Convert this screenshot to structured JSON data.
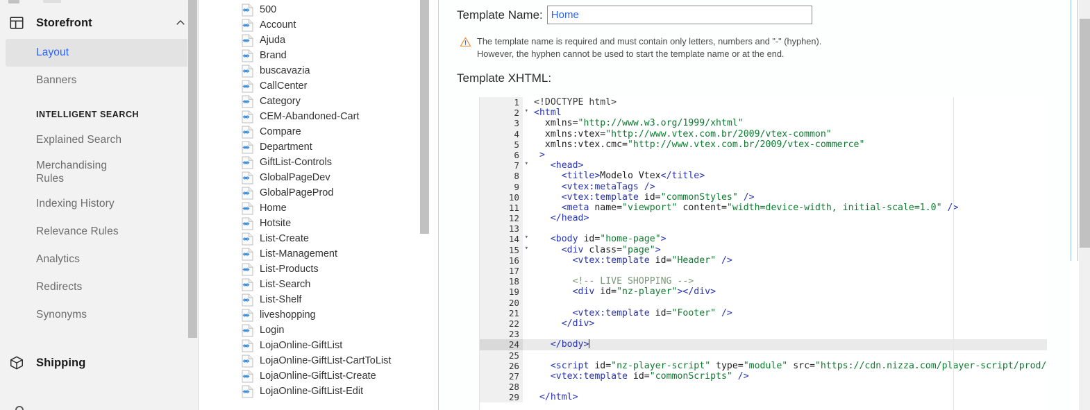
{
  "sidebar": {
    "section": {
      "icon": "layout-grid-icon",
      "title": "Storefront",
      "chevron": "chevron-up-icon"
    },
    "items": [
      {
        "label": "Layout",
        "active": true
      },
      {
        "label": "Banners",
        "active": false
      }
    ],
    "group_label": "INTELLIGENT SEARCH",
    "search_items": [
      {
        "label": "Explained Search"
      },
      {
        "label": "Merchandising Rules"
      },
      {
        "label": "Indexing History"
      },
      {
        "label": "Relevance Rules"
      },
      {
        "label": "Analytics"
      },
      {
        "label": "Redirects"
      },
      {
        "label": "Synonyms"
      }
    ],
    "shipping": {
      "icon": "box-cube-icon",
      "title": "Shipping"
    },
    "accent_color": "#2a64f6",
    "active_bg": "#e3e3e3",
    "background": "#f2f2f2"
  },
  "template_list": {
    "icon_name": "xml-file-icon",
    "items": [
      "500",
      "Account",
      "Ajuda",
      "Brand",
      "buscavazia",
      "CallCenter",
      "Category",
      "CEM-Abandoned-Cart",
      "Compare",
      "Department",
      "GiftList-Controls",
      "GlobalPageDev",
      "GlobalPageProd",
      "Home",
      "Hotsite",
      "List-Create",
      "List-Management",
      "List-Products",
      "List-Search",
      "List-Shelf",
      "liveshopping",
      "Login",
      "LojaOnline-GiftList",
      "LojaOnline-GiftList-CartToList",
      "LojaOnline-GiftList-Create",
      "LojaOnline-GiftList-Edit"
    ]
  },
  "main": {
    "template_name_label": "Template Name:",
    "template_name_value": "Home",
    "template_name_placeholder": "Template Name",
    "warning_icon": "warning-triangle-icon",
    "warning_line1": "The template name is required and must contain only letters, numbers and \"-\" (hyphen).",
    "warning_line2": "However, the hyphen cannot be used to start the template name or at the end.",
    "xhtml_label": "Template XHTML:"
  },
  "editor": {
    "active_line": 24,
    "lines": [
      {
        "n": 1,
        "fold": false,
        "tokens": [
          {
            "c": "t-dt",
            "t": "<!DOCTYPE html>"
          }
        ]
      },
      {
        "n": 2,
        "fold": true,
        "tokens": [
          {
            "c": "t-tag",
            "t": "<html"
          }
        ]
      },
      {
        "n": 3,
        "fold": false,
        "tokens": [
          {
            "c": "t-txt",
            "t": "  xmlns="
          },
          {
            "c": "t-str",
            "t": "\"http://www.w3.org/1999/xhtml\""
          }
        ]
      },
      {
        "n": 4,
        "fold": false,
        "tokens": [
          {
            "c": "t-txt",
            "t": "  xmlns:vtex="
          },
          {
            "c": "t-str",
            "t": "\"http://www.vtex.com.br/2009/vtex-common\""
          }
        ]
      },
      {
        "n": 5,
        "fold": false,
        "tokens": [
          {
            "c": "t-txt",
            "t": "  xmlns:vtex.cmc="
          },
          {
            "c": "t-str",
            "t": "\"http://www.vtex.com.br/2009/vtex-commerce\""
          }
        ]
      },
      {
        "n": 6,
        "fold": false,
        "tokens": [
          {
            "c": "t-pun",
            "t": " >"
          }
        ]
      },
      {
        "n": 7,
        "fold": true,
        "tokens": [
          {
            "c": "t-tag",
            "t": "   <head>"
          }
        ]
      },
      {
        "n": 8,
        "fold": false,
        "tokens": [
          {
            "c": "t-tag",
            "t": "     <title>"
          },
          {
            "c": "t-txt",
            "t": "Modelo Vtex"
          },
          {
            "c": "t-tag",
            "t": "</title>"
          }
        ]
      },
      {
        "n": 9,
        "fold": false,
        "tokens": [
          {
            "c": "t-tag",
            "t": "     <vtex:metaTags "
          },
          {
            "c": "t-pun",
            "t": "/>"
          }
        ]
      },
      {
        "n": 10,
        "fold": false,
        "tokens": [
          {
            "c": "t-tag",
            "t": "     <vtex:template "
          },
          {
            "c": "t-txt",
            "t": "id="
          },
          {
            "c": "t-str",
            "t": "\"commonStyles\""
          },
          {
            "c": "t-pun",
            "t": " />"
          }
        ]
      },
      {
        "n": 11,
        "fold": false,
        "tokens": [
          {
            "c": "t-tag",
            "t": "     <meta "
          },
          {
            "c": "t-txt",
            "t": "name="
          },
          {
            "c": "t-str",
            "t": "\"viewport\""
          },
          {
            "c": "t-txt",
            "t": " content="
          },
          {
            "c": "t-str",
            "t": "\"width=device-width, initial-scale=1.0\""
          },
          {
            "c": "t-pun",
            "t": " />"
          }
        ]
      },
      {
        "n": 12,
        "fold": false,
        "tokens": [
          {
            "c": "t-tag",
            "t": "   </head>"
          }
        ]
      },
      {
        "n": 13,
        "fold": false,
        "tokens": [
          {
            "c": "t-txt",
            "t": ""
          }
        ]
      },
      {
        "n": 14,
        "fold": true,
        "tokens": [
          {
            "c": "t-tag",
            "t": "   <body "
          },
          {
            "c": "t-txt",
            "t": "id="
          },
          {
            "c": "t-str",
            "t": "\"home-page\""
          },
          {
            "c": "t-tag",
            "t": ">"
          }
        ]
      },
      {
        "n": 15,
        "fold": true,
        "tokens": [
          {
            "c": "t-tag",
            "t": "     <div "
          },
          {
            "c": "t-txt",
            "t": "class="
          },
          {
            "c": "t-str",
            "t": "\"page\""
          },
          {
            "c": "t-tag",
            "t": ">"
          }
        ]
      },
      {
        "n": 16,
        "fold": false,
        "tokens": [
          {
            "c": "t-tag",
            "t": "       <vtex:template "
          },
          {
            "c": "t-txt",
            "t": "id="
          },
          {
            "c": "t-str",
            "t": "\"Header\""
          },
          {
            "c": "t-pun",
            "t": " />"
          }
        ]
      },
      {
        "n": 17,
        "fold": false,
        "tokens": [
          {
            "c": "t-txt",
            "t": ""
          }
        ]
      },
      {
        "n": 18,
        "fold": false,
        "tokens": [
          {
            "c": "t-com",
            "t": "       <!-- LIVE SHOPPING -->"
          }
        ]
      },
      {
        "n": 19,
        "fold": false,
        "tokens": [
          {
            "c": "t-tag",
            "t": "       <div "
          },
          {
            "c": "t-txt",
            "t": "id="
          },
          {
            "c": "t-str",
            "t": "\"nz-player\""
          },
          {
            "c": "t-tag",
            "t": "></div>"
          }
        ]
      },
      {
        "n": 20,
        "fold": false,
        "tokens": [
          {
            "c": "t-txt",
            "t": ""
          }
        ]
      },
      {
        "n": 21,
        "fold": false,
        "tokens": [
          {
            "c": "t-tag",
            "t": "       <vtex:template "
          },
          {
            "c": "t-txt",
            "t": "id="
          },
          {
            "c": "t-str",
            "t": "\"Footer\""
          },
          {
            "c": "t-pun",
            "t": " />"
          }
        ]
      },
      {
        "n": 22,
        "fold": false,
        "tokens": [
          {
            "c": "t-tag",
            "t": "     </div>"
          }
        ]
      },
      {
        "n": 23,
        "fold": false,
        "tokens": [
          {
            "c": "t-txt",
            "t": ""
          }
        ]
      },
      {
        "n": 24,
        "fold": false,
        "tokens": [
          {
            "c": "t-tag",
            "t": "   </body>"
          }
        ],
        "caret": true
      },
      {
        "n": 25,
        "fold": false,
        "tokens": [
          {
            "c": "t-txt",
            "t": ""
          }
        ]
      },
      {
        "n": 26,
        "fold": false,
        "tokens": [
          {
            "c": "t-tag",
            "t": "   <script "
          },
          {
            "c": "t-txt",
            "t": "id="
          },
          {
            "c": "t-str",
            "t": "\"nz-player-script\""
          },
          {
            "c": "t-txt",
            "t": " type="
          },
          {
            "c": "t-str",
            "t": "\"module\""
          },
          {
            "c": "t-txt",
            "t": " src="
          },
          {
            "c": "t-str",
            "t": "\"https://cdn.nizza.com/player-script/prod/nz-ps-index"
          }
        ]
      },
      {
        "n": 27,
        "fold": false,
        "tokens": [
          {
            "c": "t-tag",
            "t": "   <vtex:template "
          },
          {
            "c": "t-txt",
            "t": "id="
          },
          {
            "c": "t-str",
            "t": "\"commonScripts\""
          },
          {
            "c": "t-pun",
            "t": " />"
          }
        ]
      },
      {
        "n": 28,
        "fold": false,
        "tokens": [
          {
            "c": "t-txt",
            "t": ""
          }
        ]
      },
      {
        "n": 29,
        "fold": false,
        "tokens": [
          {
            "c": "t-tag",
            "t": " </html>"
          }
        ]
      }
    ]
  }
}
